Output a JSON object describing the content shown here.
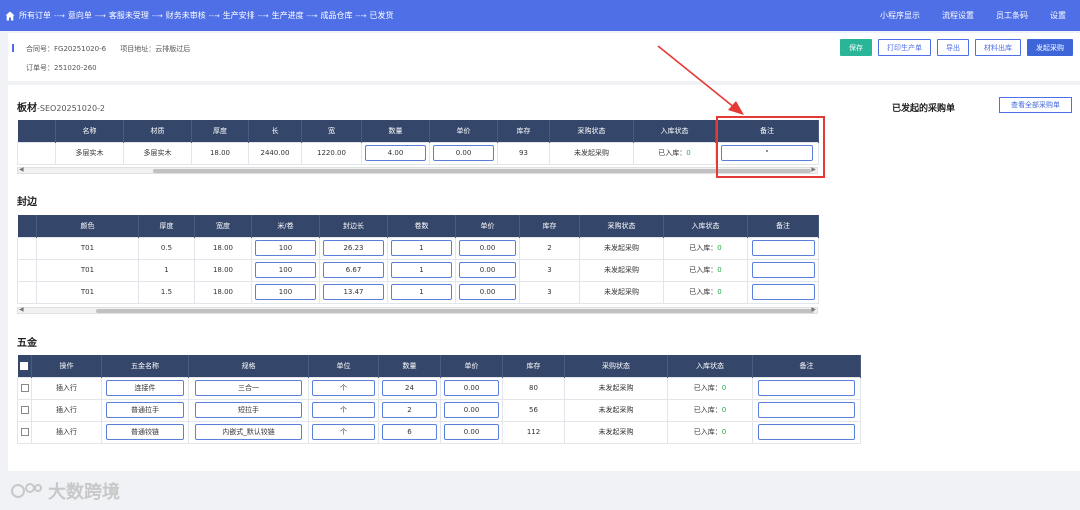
{
  "nav": {
    "crumbs": [
      "所有订单",
      "意向单",
      "客服未受理",
      "财务未审核",
      "生产安排",
      "生产进度",
      "成品仓库",
      "已发货"
    ],
    "links": [
      "小程序显示",
      "流程设置",
      "员工条码",
      "设置"
    ]
  },
  "info": {
    "contract_label": "合同号：",
    "contract_no": "FG20251020-6",
    "project_label": "项目地址：",
    "project": "云排版过后",
    "order_label": "订单号：",
    "order_no": "251020-260"
  },
  "buttons": [
    "保存",
    "打印生产单",
    "导出",
    "材料出库",
    "发起采购"
  ],
  "sheet": {
    "title": "板材",
    "code": "-SEO20251020-2",
    "headers": [
      "名称",
      "材质",
      "厚度",
      "长",
      "宽",
      "数量",
      "单价",
      "库存",
      "采购状态",
      "入库状态",
      "备注"
    ],
    "rows": [
      {
        "name": "多层实木",
        "material": "多层实木",
        "thickness": "18.00",
        "length": "2440.00",
        "width": "1220.00",
        "qty": "4.00",
        "price": "0.00",
        "stock": "93",
        "status": "未发起采购",
        "in_label": "已入库：",
        "in_val": "0",
        "note": "\""
      }
    ]
  },
  "edge": {
    "title": "封边",
    "headers": [
      "颜色",
      "厚度",
      "宽度",
      "米/卷",
      "封边长",
      "卷数",
      "单价",
      "库存",
      "采购状态",
      "入库状态",
      "备注"
    ],
    "rows": [
      {
        "color": "T01",
        "thickness": "0.5",
        "width": "18.00",
        "per_roll": "100",
        "length": "26.23",
        "rolls": "1",
        "price": "0.00",
        "stock": "2",
        "status": "未发起采购",
        "in_label": "已入库：",
        "in_val": "0",
        "note": ""
      },
      {
        "color": "T01",
        "thickness": "1",
        "width": "18.00",
        "per_roll": "100",
        "length": "6.67",
        "rolls": "1",
        "price": "0.00",
        "stock": "3",
        "status": "未发起采购",
        "in_label": "已入库：",
        "in_val": "0",
        "note": ""
      },
      {
        "color": "T01",
        "thickness": "1.5",
        "width": "18.00",
        "per_roll": "100",
        "length": "13.47",
        "rolls": "1",
        "price": "0.00",
        "stock": "3",
        "status": "未发起采购",
        "in_label": "已入库：",
        "in_val": "0",
        "note": ""
      }
    ]
  },
  "hardware": {
    "title": "五金",
    "headers": [
      "操作",
      "五金名称",
      "规格",
      "单位",
      "数量",
      "单价",
      "库存",
      "采购状态",
      "入库状态",
      "备注"
    ],
    "rows": [
      {
        "op": "插入行",
        "name": "连接件",
        "spec": "三合一",
        "unit": "个",
        "qty": "24",
        "price": "0.00",
        "stock": "80",
        "status": "未发起采购",
        "in_label": "已入库：",
        "in_val": "0",
        "note": ""
      },
      {
        "op": "插入行",
        "name": "普通拉手",
        "spec": "短拉手",
        "unit": "个",
        "qty": "2",
        "price": "0.00",
        "stock": "56",
        "status": "未发起采购",
        "in_label": "已入库：",
        "in_val": "0",
        "note": ""
      },
      {
        "op": "插入行",
        "name": "普通铰链",
        "spec": "内嵌式_默认铰链",
        "unit": "个",
        "qty": "6",
        "price": "0.00",
        "stock": "112",
        "status": "未发起采购",
        "in_label": "已入库：",
        "in_val": "0",
        "note": ""
      }
    ]
  },
  "side": {
    "title": "已发起的采购单",
    "view_all": "查看全部采购单"
  },
  "watermark": "大数跨境",
  "colors": {
    "nav": "#4e6fe6",
    "header": "#34466a",
    "danger": "#e53935",
    "success": "#27a84a"
  }
}
